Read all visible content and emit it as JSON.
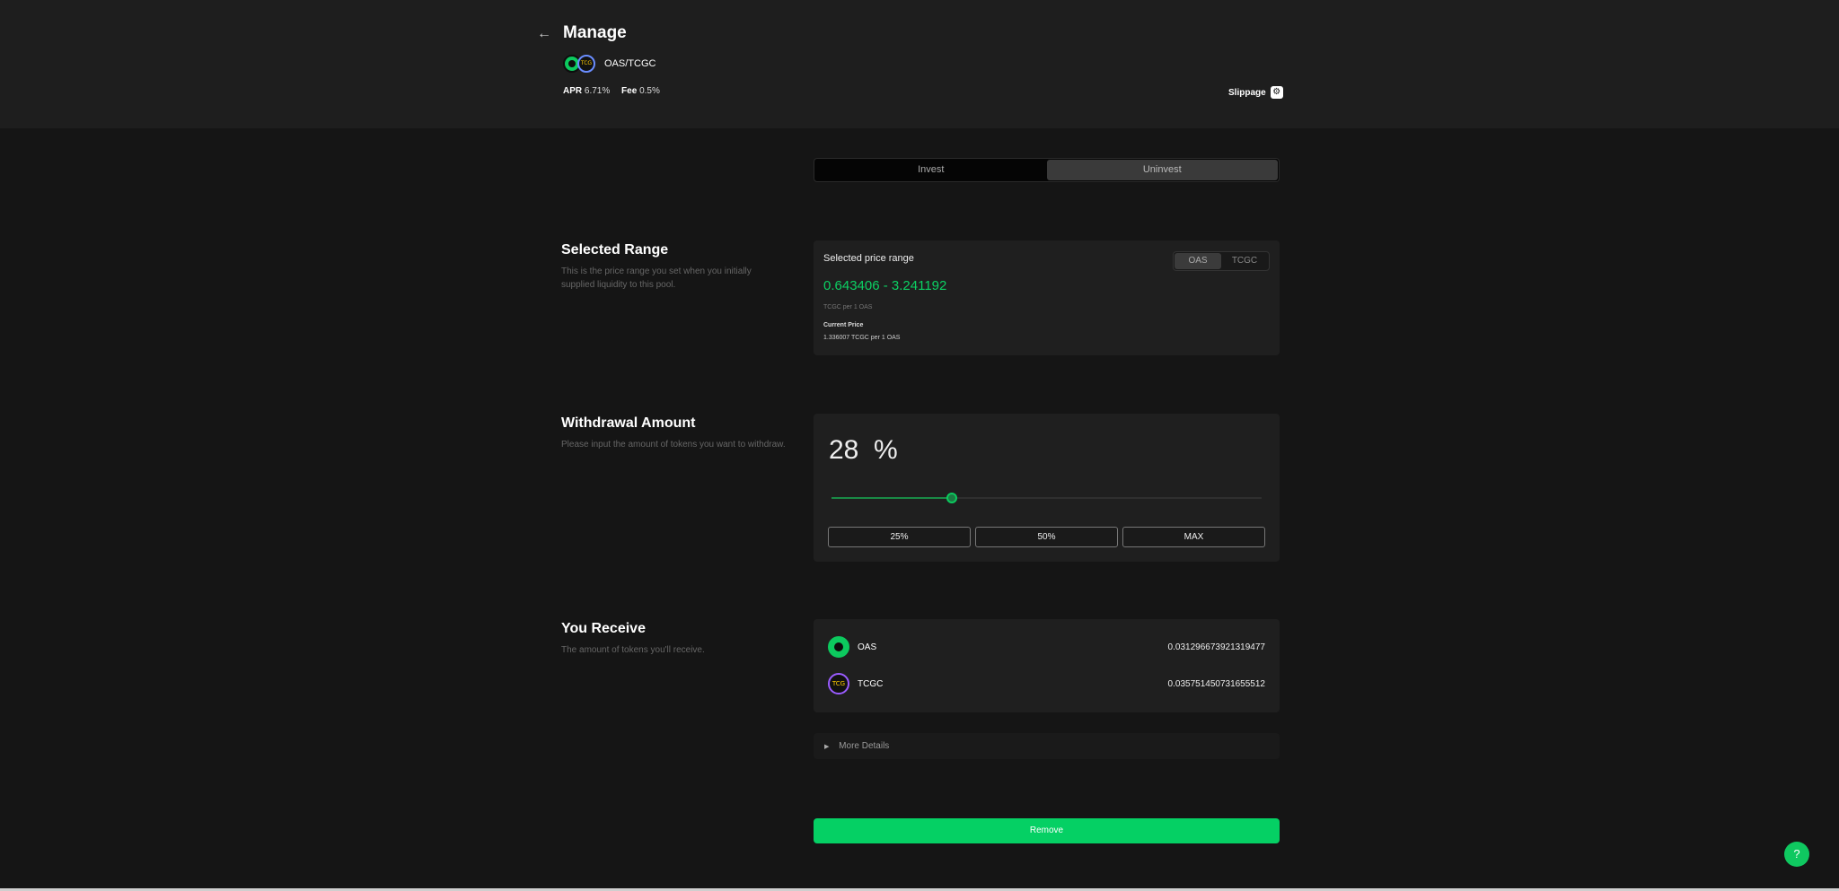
{
  "header": {
    "back_icon": "arrow-left-icon",
    "title": "Manage",
    "pair": "OAS/TCGC",
    "token_a_icon_text": "",
    "token_b_icon_text": "TCG",
    "apr_label": "APR",
    "apr_value": "6.71%",
    "fee_label": "Fee",
    "fee_value": "0.5%",
    "slippage_label": "Slippage",
    "slippage_icon": "gear-icon"
  },
  "tabs": [
    "Invest",
    "Uninvest"
  ],
  "active_tab": "Uninvest",
  "selected_range": {
    "title": "Selected Range",
    "description": "This is the price range you set when you initially supplied liquidity to this pool.",
    "card_label": "Selected price range",
    "toggle": [
      "OAS",
      "TCGC"
    ],
    "toggle_selected": "OAS",
    "range": "0.643406 - 3.241192",
    "unit": "TCGC per 1 OAS",
    "current_price_label": "Current Price",
    "current_price": "1.336007 TCGC per 1 OAS"
  },
  "withdrawal": {
    "title": "Withdrawal Amount",
    "description": "Please input the amount of tokens you want to withdraw.",
    "percent_display": "28  %",
    "percent_value": 28,
    "quick_buttons": [
      "25%",
      "50%",
      "MAX"
    ]
  },
  "receive": {
    "title": "You Receive",
    "description": "The amount of tokens you'll receive.",
    "tokens": [
      {
        "symbol": "OAS",
        "amount": "0.031296673921319477"
      },
      {
        "symbol": "TCGC",
        "amount": "0.035751450731655512"
      }
    ]
  },
  "more_details_label": "More Details",
  "remove_label": "Remove",
  "help_label": "?",
  "colors": {
    "accent": "#05d064",
    "range_text": "#0cd063",
    "background": "#151515",
    "header_bg": "#1e1e1e",
    "card_bg": "#1f1f1f"
  }
}
